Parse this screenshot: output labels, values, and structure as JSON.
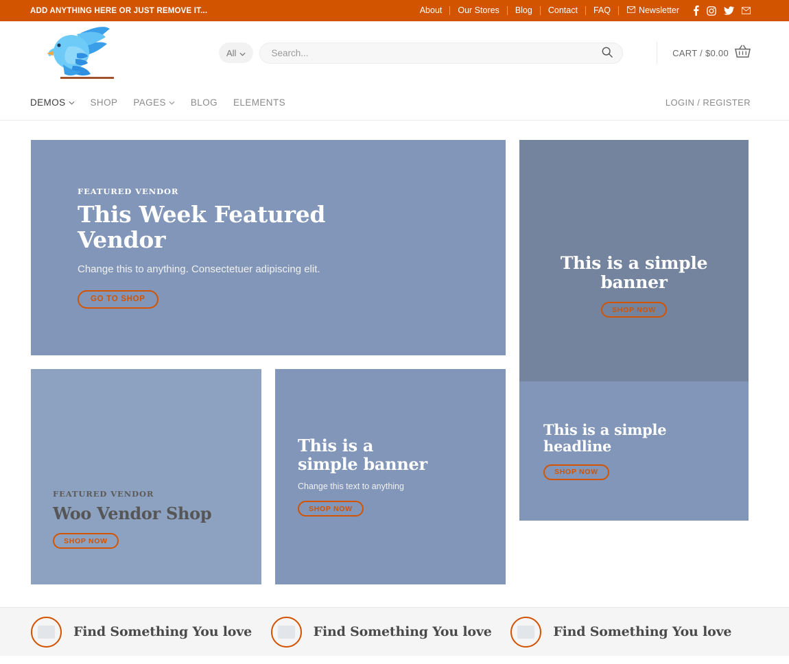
{
  "topbar": {
    "tagline": "ADD ANYTHING HERE OR JUST REMOVE IT...",
    "links": [
      {
        "label": "About"
      },
      {
        "label": "Our Stores"
      },
      {
        "label": "Blog"
      },
      {
        "label": "Contact"
      },
      {
        "label": "FAQ"
      }
    ],
    "newsletter_label": "Newsletter",
    "newsletter_icon": "envelope-icon",
    "social": [
      {
        "name": "facebook-icon"
      },
      {
        "name": "instagram-icon"
      },
      {
        "name": "twitter-icon"
      },
      {
        "name": "email-icon"
      }
    ],
    "bg_color": "#d35400"
  },
  "header": {
    "logo_alt": "bird-logo",
    "search": {
      "category_label": "All",
      "category_caret": "chevron-down-icon",
      "placeholder": "Search...",
      "value": "",
      "submit_icon": "search-icon"
    },
    "cart": {
      "label": "CART / $0.00",
      "icon": "basket-icon"
    }
  },
  "nav": {
    "items": [
      {
        "label": "DEMOS",
        "has_caret": true,
        "active": true
      },
      {
        "label": "SHOP",
        "has_caret": false,
        "active": false
      },
      {
        "label": "PAGES",
        "has_caret": true,
        "active": false
      },
      {
        "label": "BLOG",
        "has_caret": false,
        "active": false
      },
      {
        "label": "ELEMENTS",
        "has_caret": false,
        "active": false
      }
    ],
    "account_label": "LOGIN / REGISTER"
  },
  "banners": {
    "featured": {
      "eyebrow": "FEATURED VENDOR",
      "title": "This Week Featured Vendor",
      "subtitle": "Change this to anything. Consectetuer adipiscing elit.",
      "button": "GO TO SHOP",
      "bg_color": "#8196b8"
    },
    "tall": {
      "title": "This is a simple banner",
      "button": "SHOP NOW",
      "bg_color": "#74839e"
    },
    "vendor": {
      "eyebrow": "FEATURED VENDOR",
      "title": "Woo Vendor Shop",
      "button": "SHOP NOW",
      "bg_color": "#8da2c0"
    },
    "simple": {
      "title": "This is a simple banner",
      "subtitle": "Change this text to anything",
      "button": "SHOP NOW",
      "bg_color": "#8196b8"
    },
    "headline": {
      "title": "This is a simple headline",
      "button": "SHOP NOW",
      "bg_color": "#8196b8"
    }
  },
  "features": {
    "items": [
      {
        "text": "Find Something You love",
        "icon": "image-placeholder-icon"
      },
      {
        "text": "Find Something You love",
        "icon": "image-placeholder-icon"
      },
      {
        "text": "Find Something You love",
        "icon": "image-placeholder-icon"
      }
    ],
    "accent_color": "#d35400"
  }
}
